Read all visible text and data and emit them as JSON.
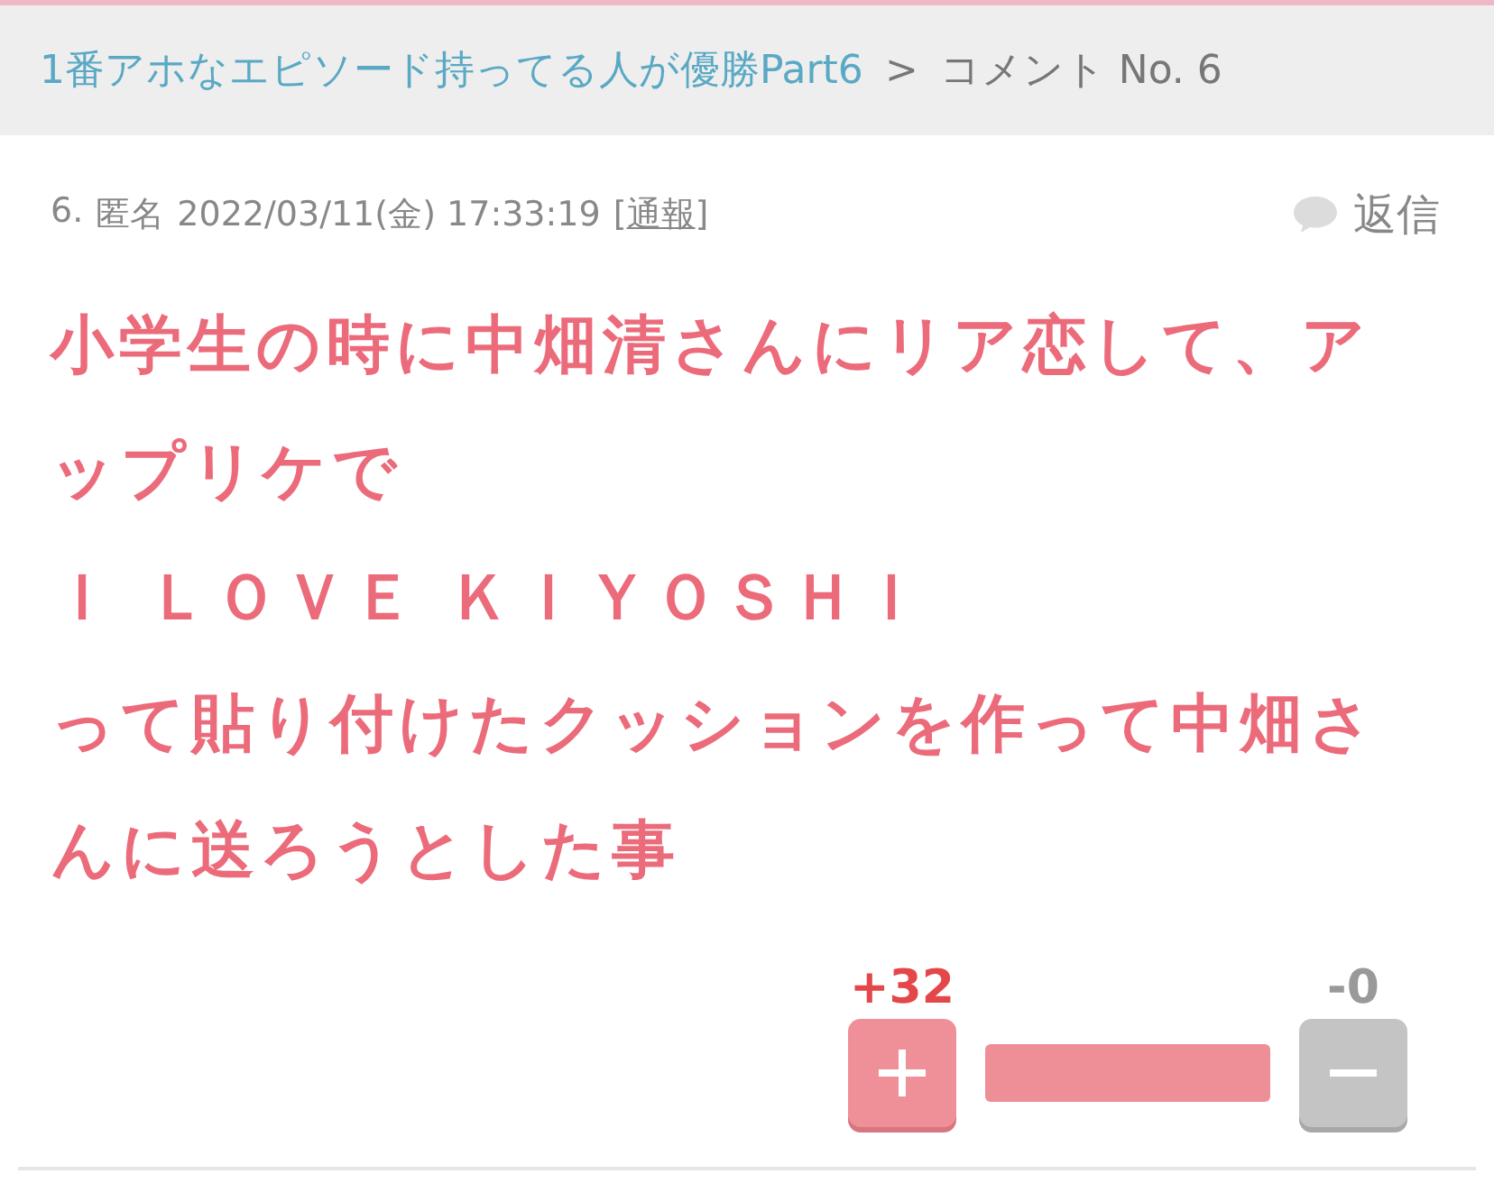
{
  "breadcrumb": {
    "link": "1番アホなエピソード持ってる人が優勝Part6",
    "separator": ">",
    "current": "コメント No. 6"
  },
  "comment": {
    "number": "6.",
    "author": "匿名",
    "datetime": "2022/03/11(金) 17:33:19",
    "report_open": "[",
    "report": "通報",
    "report_close": "]",
    "reply": "返信",
    "body": [
      "小学生の時に中畑清さんにリア恋して、アップリケで",
      "Ｉ ＬＯＶＥ ＫＩＹＯＳＨＩ",
      "って貼り付けたクッションを作って中畑さんに送ろうとした事"
    ]
  },
  "votes": {
    "plus": "+32",
    "minus": "-0",
    "level": 1
  }
}
